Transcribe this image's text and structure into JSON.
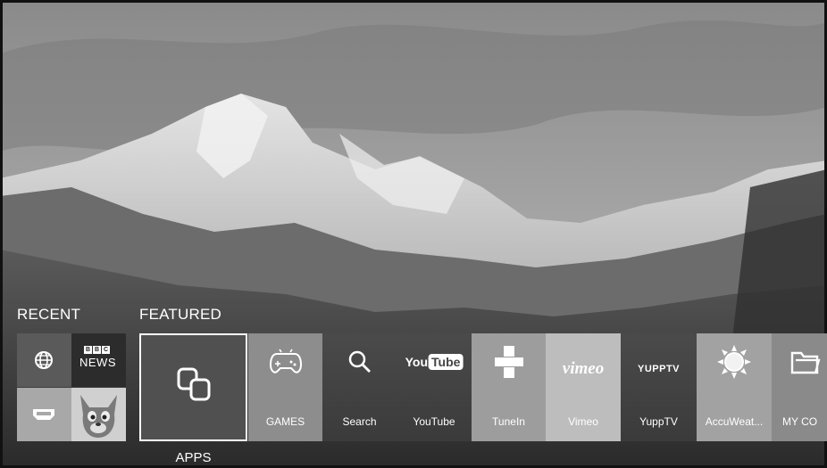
{
  "sections": {
    "recent": "RECENT",
    "featured": "FEATURED"
  },
  "recent": {
    "globe_icon": "globe-icon",
    "bbc_letters": [
      "B",
      "B",
      "C"
    ],
    "bbc_news": "NEWS",
    "hdmi_icon": "hdmi-icon",
    "tom_icon": "talking-tom-icon"
  },
  "featured": {
    "apps": {
      "label": "APPS",
      "icon": "apps-icon"
    },
    "games": {
      "label": "GAMES",
      "icon": "gamepad-icon"
    },
    "search": {
      "label": "Search",
      "icon": "search-icon"
    },
    "youtube": {
      "label": "YouTube",
      "logo_you": "You",
      "logo_tube": "Tube"
    },
    "tunein": {
      "label": "TuneIn",
      "icon": "tunein-icon"
    },
    "vimeo": {
      "label": "Vimeo",
      "logo": "vimeo"
    },
    "yupptv": {
      "label": "YuppTV",
      "logo": "YUPPTV"
    },
    "accuweather": {
      "label": "AccuWeat...",
      "icon": "sun-icon"
    },
    "mycontent": {
      "label": "MY CO",
      "icon": "folder-icon"
    }
  }
}
